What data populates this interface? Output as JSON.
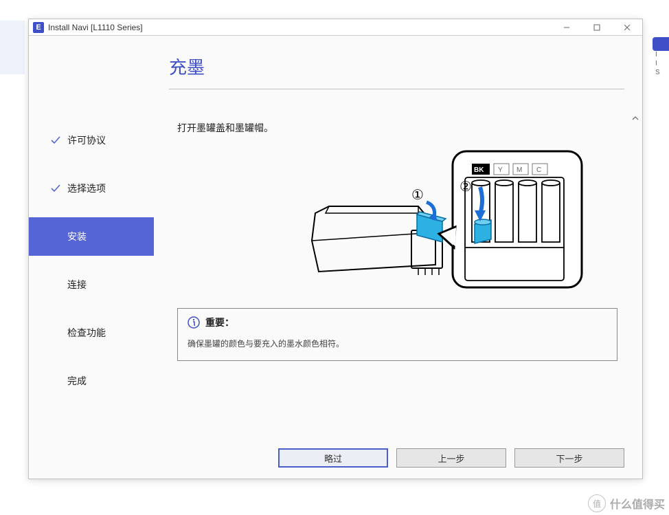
{
  "window": {
    "app_icon_letter": "E",
    "title": "Install Navi [L1110 Series]"
  },
  "page": {
    "heading": "充墨",
    "instruction": "打开墨罐盖和墨罐帽。"
  },
  "steps": [
    {
      "label": "许可协议",
      "completed": true,
      "active": false
    },
    {
      "label": "选择选项",
      "completed": true,
      "active": false
    },
    {
      "label": "安装",
      "completed": false,
      "active": true
    },
    {
      "label": "连接",
      "completed": false,
      "active": false
    },
    {
      "label": "检查功能",
      "completed": false,
      "active": false
    },
    {
      "label": "完成",
      "completed": false,
      "active": false
    }
  ],
  "diagram": {
    "step1_label": "①",
    "step2_label": "②",
    "ink_labels": [
      "BK",
      "Y",
      "M",
      "C"
    ]
  },
  "important": {
    "heading": "重要：",
    "body": "确保墨罐的颜色与要充入的墨水颜色相符。"
  },
  "buttons": {
    "skip": "略过",
    "back": "上一步",
    "next": "下一步"
  },
  "watermark": {
    "badge": "值",
    "text": "什么值得买"
  },
  "sidebar_peek": {
    "r1": "I",
    "r2": "I",
    "r3": "S"
  }
}
